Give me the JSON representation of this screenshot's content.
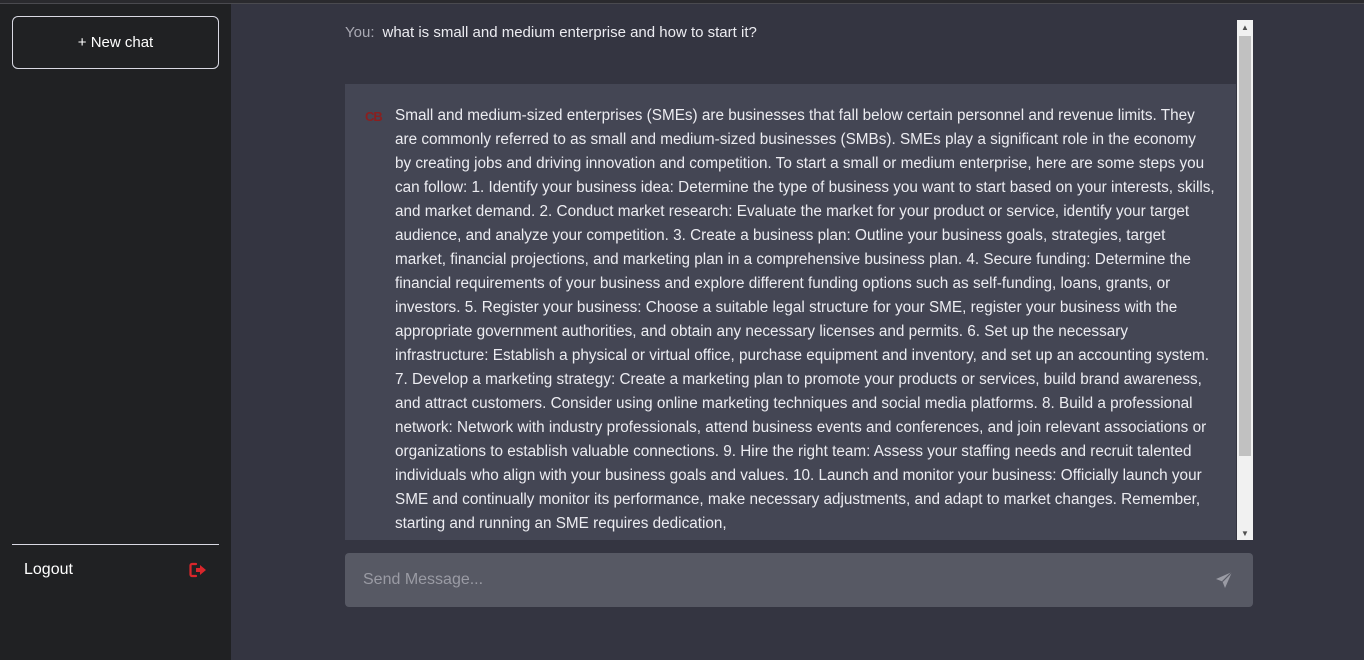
{
  "sidebar": {
    "new_chat_label": "+ New chat",
    "logout_label": "Logout"
  },
  "chat": {
    "user_prefix": "You:",
    "user_message": "what is small and medium enterprise and how to start it?",
    "bot_avatar_text": "CB",
    "bot_message": "Small and medium-sized enterprises (SMEs) are businesses that fall below certain personnel and revenue limits. They are commonly referred to as small and medium-sized businesses (SMBs). SMEs play a significant role in the economy by creating jobs and driving innovation and competition. To start a small or medium enterprise, here are some steps you can follow: 1. Identify your business idea: Determine the type of business you want to start based on your interests, skills, and market demand. 2. Conduct market research: Evaluate the market for your product or service, identify your target audience, and analyze your competition. 3. Create a business plan: Outline your business goals, strategies, target market, financial projections, and marketing plan in a comprehensive business plan. 4. Secure funding: Determine the financial requirements of your business and explore different funding options such as self-funding, loans, grants, or investors. 5. Register your business: Choose a suitable legal structure for your SME, register your business with the appropriate government authorities, and obtain any necessary licenses and permits. 6. Set up the necessary infrastructure: Establish a physical or virtual office, purchase equipment and inventory, and set up an accounting system. 7. Develop a marketing strategy: Create a marketing plan to promote your products or services, build brand awareness, and attract customers. Consider using online marketing techniques and social media platforms. 8. Build a professional network: Network with industry professionals, attend business events and conferences, and join relevant associations or organizations to establish valuable connections. 9. Hire the right team: Assess your staffing needs and recruit talented individuals who align with your business goals and values. 10. Launch and monitor your business: Officially launch your SME and continually monitor its performance, make necessary adjustments, and adapt to market changes. Remember, starting and running an SME requires dedication,"
  },
  "input": {
    "placeholder": "Send Message..."
  },
  "icons": {
    "logout": "logout-icon",
    "send": "send-icon"
  },
  "colors": {
    "sidebar_bg": "#202123",
    "main_bg": "#343541",
    "bot_bg": "#444654",
    "input_bg": "#575964",
    "logout_icon": "#d9262b"
  }
}
